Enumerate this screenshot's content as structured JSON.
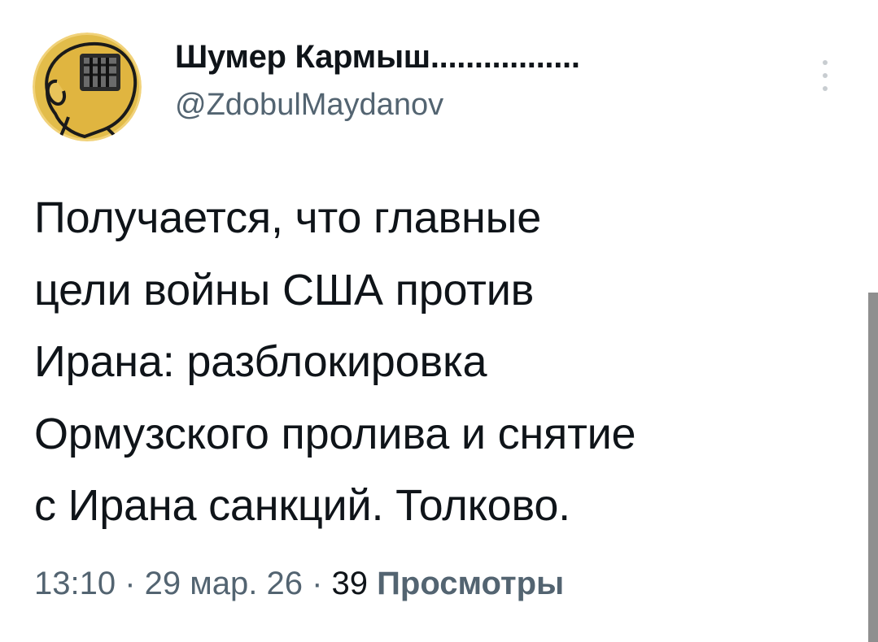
{
  "author": {
    "name": "Шумер Кармыш.................",
    "handle": "@ZdobulMaydanov",
    "avatar_icon": "cartoon-head-avatar"
  },
  "tweet": {
    "text_lines": [
      "Получается, что главные",
      "цели войны США против",
      "Ирана: разблокировка",
      "Ормузского пролива и снятие",
      "с Ирана санкций. Толково."
    ]
  },
  "meta": {
    "time": "13:10",
    "separator": " · ",
    "date": "29 мар. 26",
    "views_count": "39",
    "views_label": "Просмотры"
  },
  "more_icon": "more-vertical-icon",
  "colors": {
    "text": "#0f1419",
    "secondary": "#536471",
    "avatar_bg": "#e2bc4a",
    "scrollbar": "#8f8f8f"
  }
}
